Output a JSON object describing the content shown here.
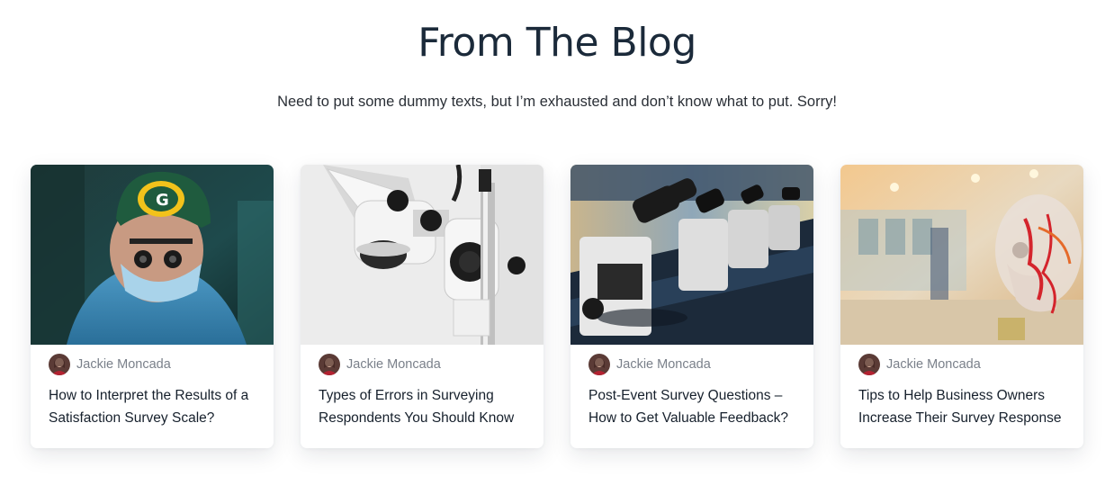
{
  "section": {
    "title": "From The Blog",
    "subtitle": "Need to put some dummy texts, but I’m exhausted and don’t know what to put. Sorry!"
  },
  "posts": [
    {
      "author": "Jackie Moncada",
      "title": "How to Interpret the Results of a Satisfaction Survey Scale?",
      "image": "surgeon-with-loupes-photo"
    },
    {
      "author": "Jackie Moncada",
      "title": "Types of Errors in Surveying Respondents You Should Know",
      "image": "white-microscope-photo"
    },
    {
      "author": "Jackie Moncada",
      "title": "Post-Event Survey Questions – How to Get Valuable Feedback?",
      "image": "lab-microscopes-row-photo"
    },
    {
      "author": "Jackie Moncada",
      "title": "Tips to Help Business Owners Increase Their Survey Response",
      "image": "anatomical-skull-model-photo"
    }
  ],
  "colors": {
    "heading": "#1b2a3a",
    "author": "#7a808a",
    "card_bg": "#ffffff"
  }
}
